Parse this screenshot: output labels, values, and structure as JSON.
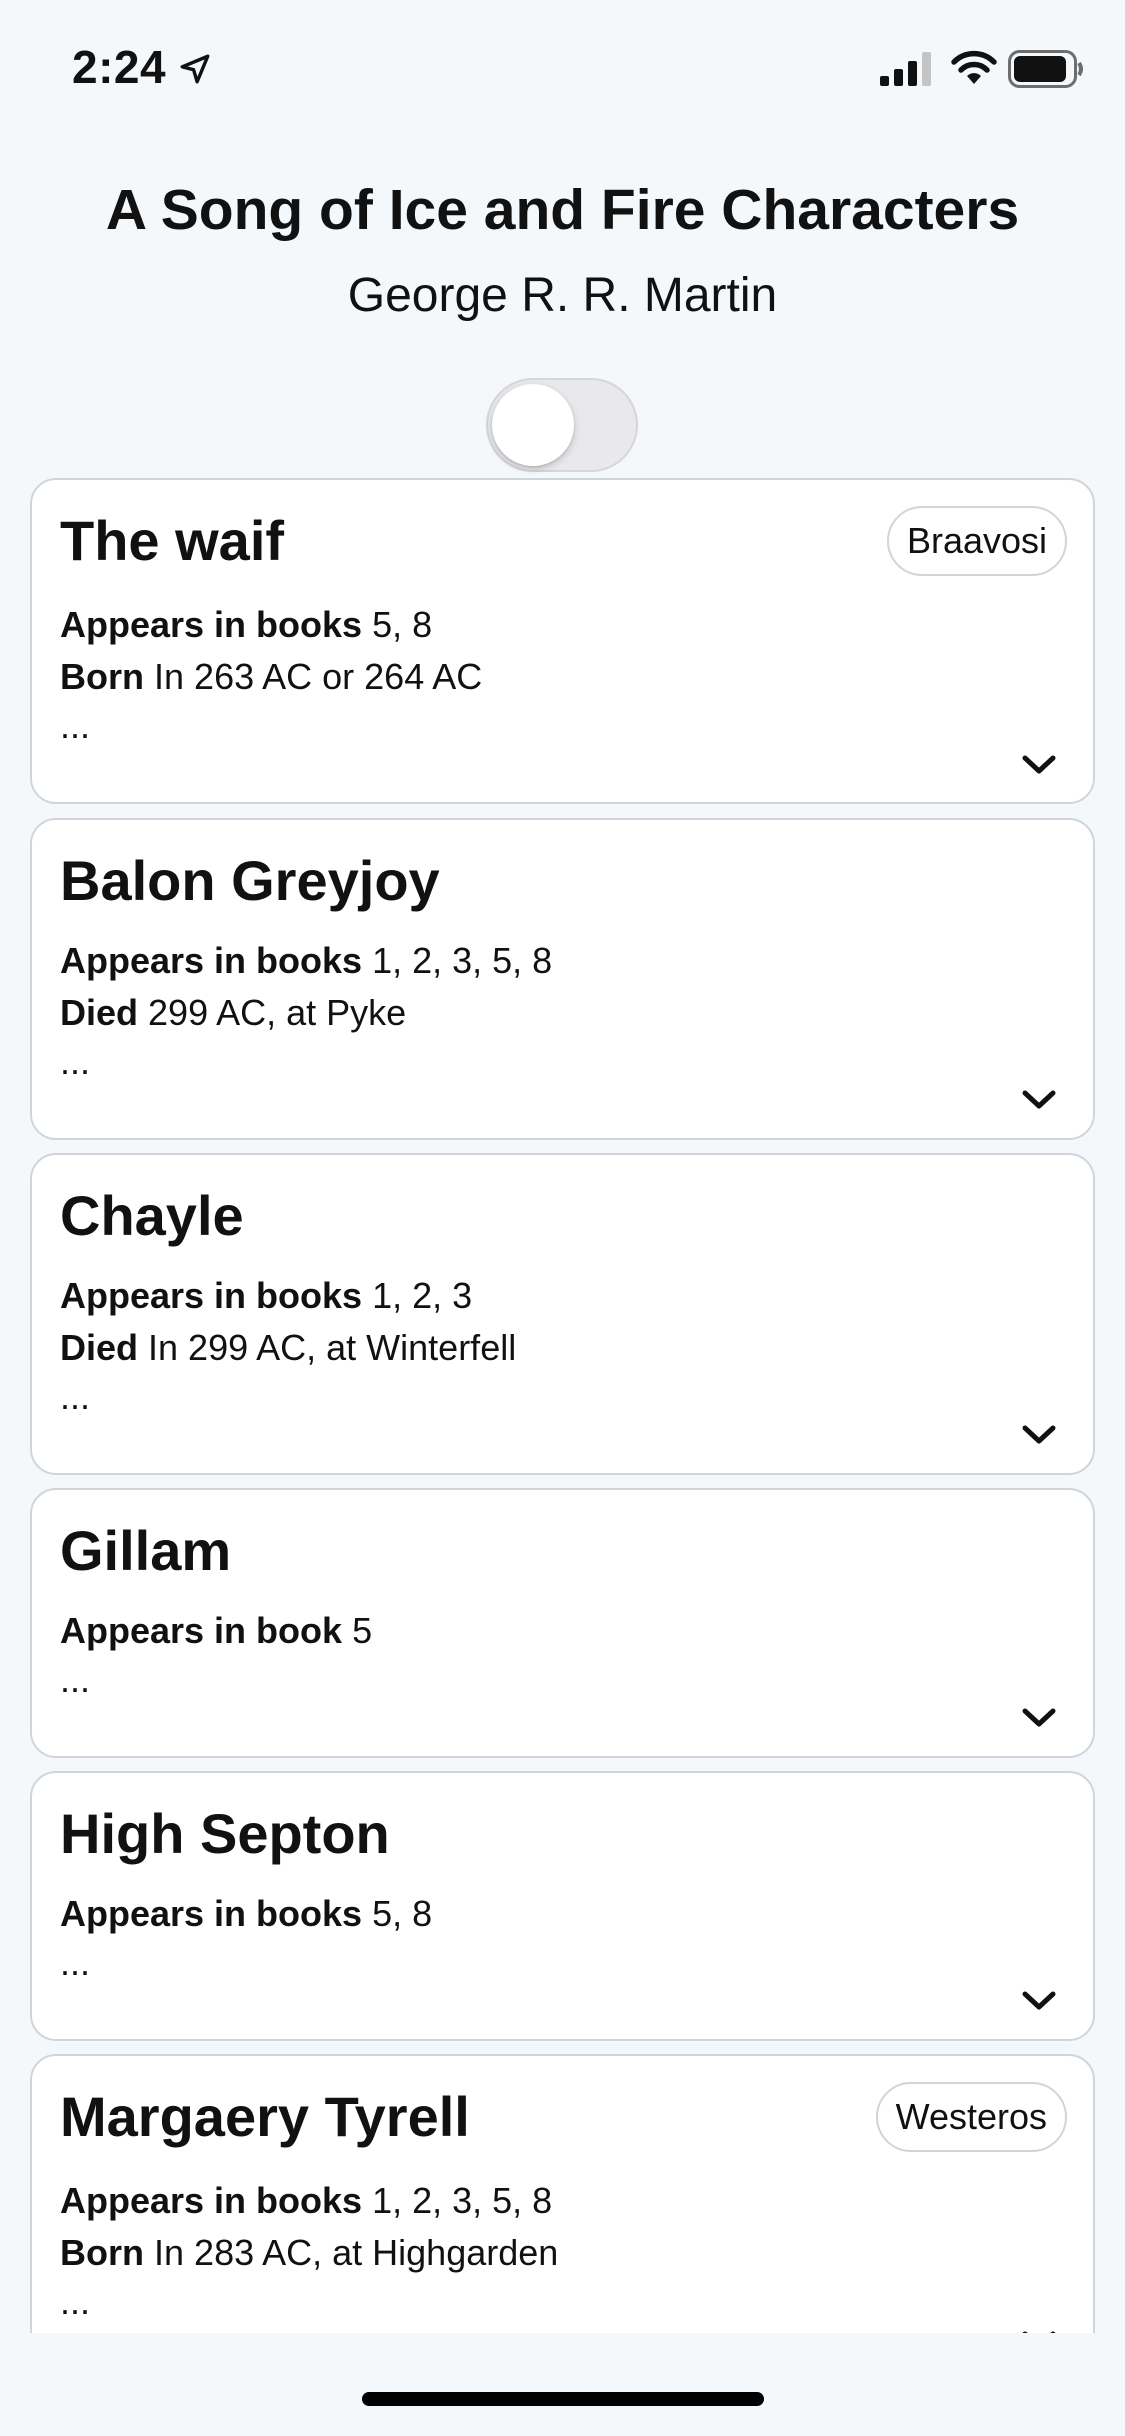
{
  "status_bar": {
    "time": "2:24"
  },
  "header": {
    "title": "A Song of Ice and Fire Characters",
    "subtitle": "George R. R. Martin"
  },
  "toggle": {
    "on": false
  },
  "characters": [
    {
      "name": "The waif",
      "badge": "Braavosi",
      "appears_label": "Appears in books",
      "appears_value": "5, 8",
      "detail_label": "Born",
      "detail_value": "In 263 AC or 264 AC",
      "more": "..."
    },
    {
      "name": "Balon Greyjoy",
      "badge": "",
      "appears_label": "Appears in books",
      "appears_value": "1, 2, 3, 5, 8",
      "detail_label": "Died",
      "detail_value": "299 AC, at Pyke",
      "more": "..."
    },
    {
      "name": "Chayle",
      "badge": "",
      "appears_label": "Appears in books",
      "appears_value": "1, 2, 3",
      "detail_label": "Died",
      "detail_value": "In 299 AC, at Winterfell",
      "more": "..."
    },
    {
      "name": "Gillam",
      "badge": "",
      "appears_label": "Appears in book",
      "appears_value": "5",
      "detail_label": "",
      "detail_value": "",
      "more": "..."
    },
    {
      "name": "High Septon",
      "badge": "",
      "appears_label": "Appears in books",
      "appears_value": "5, 8",
      "detail_label": "",
      "detail_value": "",
      "more": "..."
    },
    {
      "name": "Margaery Tyrell",
      "badge": "Westeros",
      "appears_label": "Appears in books",
      "appears_value": "1, 2, 3, 5, 8",
      "detail_label": "Born",
      "detail_value": "In 283 AC, at Highgarden",
      "more": "..."
    }
  ]
}
